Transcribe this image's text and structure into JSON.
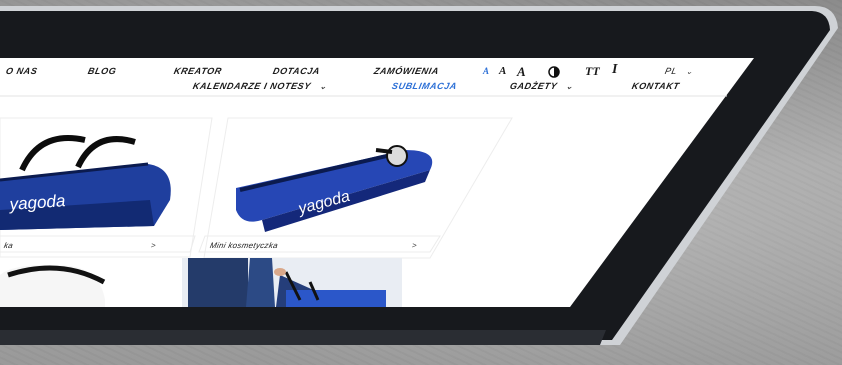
{
  "nav": {
    "row1": [
      "O NAS",
      "BLOG",
      "KREATOR",
      "DOTACJA",
      "ZAMÓWIENIA"
    ],
    "row2": [
      "KALENDARZE I NOTESY",
      "SUBLIMACJA",
      "GADŻETY",
      "KONTAKT"
    ],
    "active": "SUBLIMACJA",
    "language": "PL"
  },
  "accessibility": {
    "font_small": "A",
    "font_medium": "A",
    "font_large": "A",
    "contrast_icon": "contrast-icon",
    "text_size_icon": "TT",
    "italic_text_icon": "I"
  },
  "products": [
    {
      "caption": "ka",
      "brand": "yagoda",
      "more": ">"
    },
    {
      "caption": "Mini kosmetyczka",
      "brand": "yagoda",
      "more": ">"
    }
  ],
  "colors": {
    "accent": "#2b6fd6",
    "bag_blue": "#1f3f9e",
    "bezel": "#17191d"
  }
}
